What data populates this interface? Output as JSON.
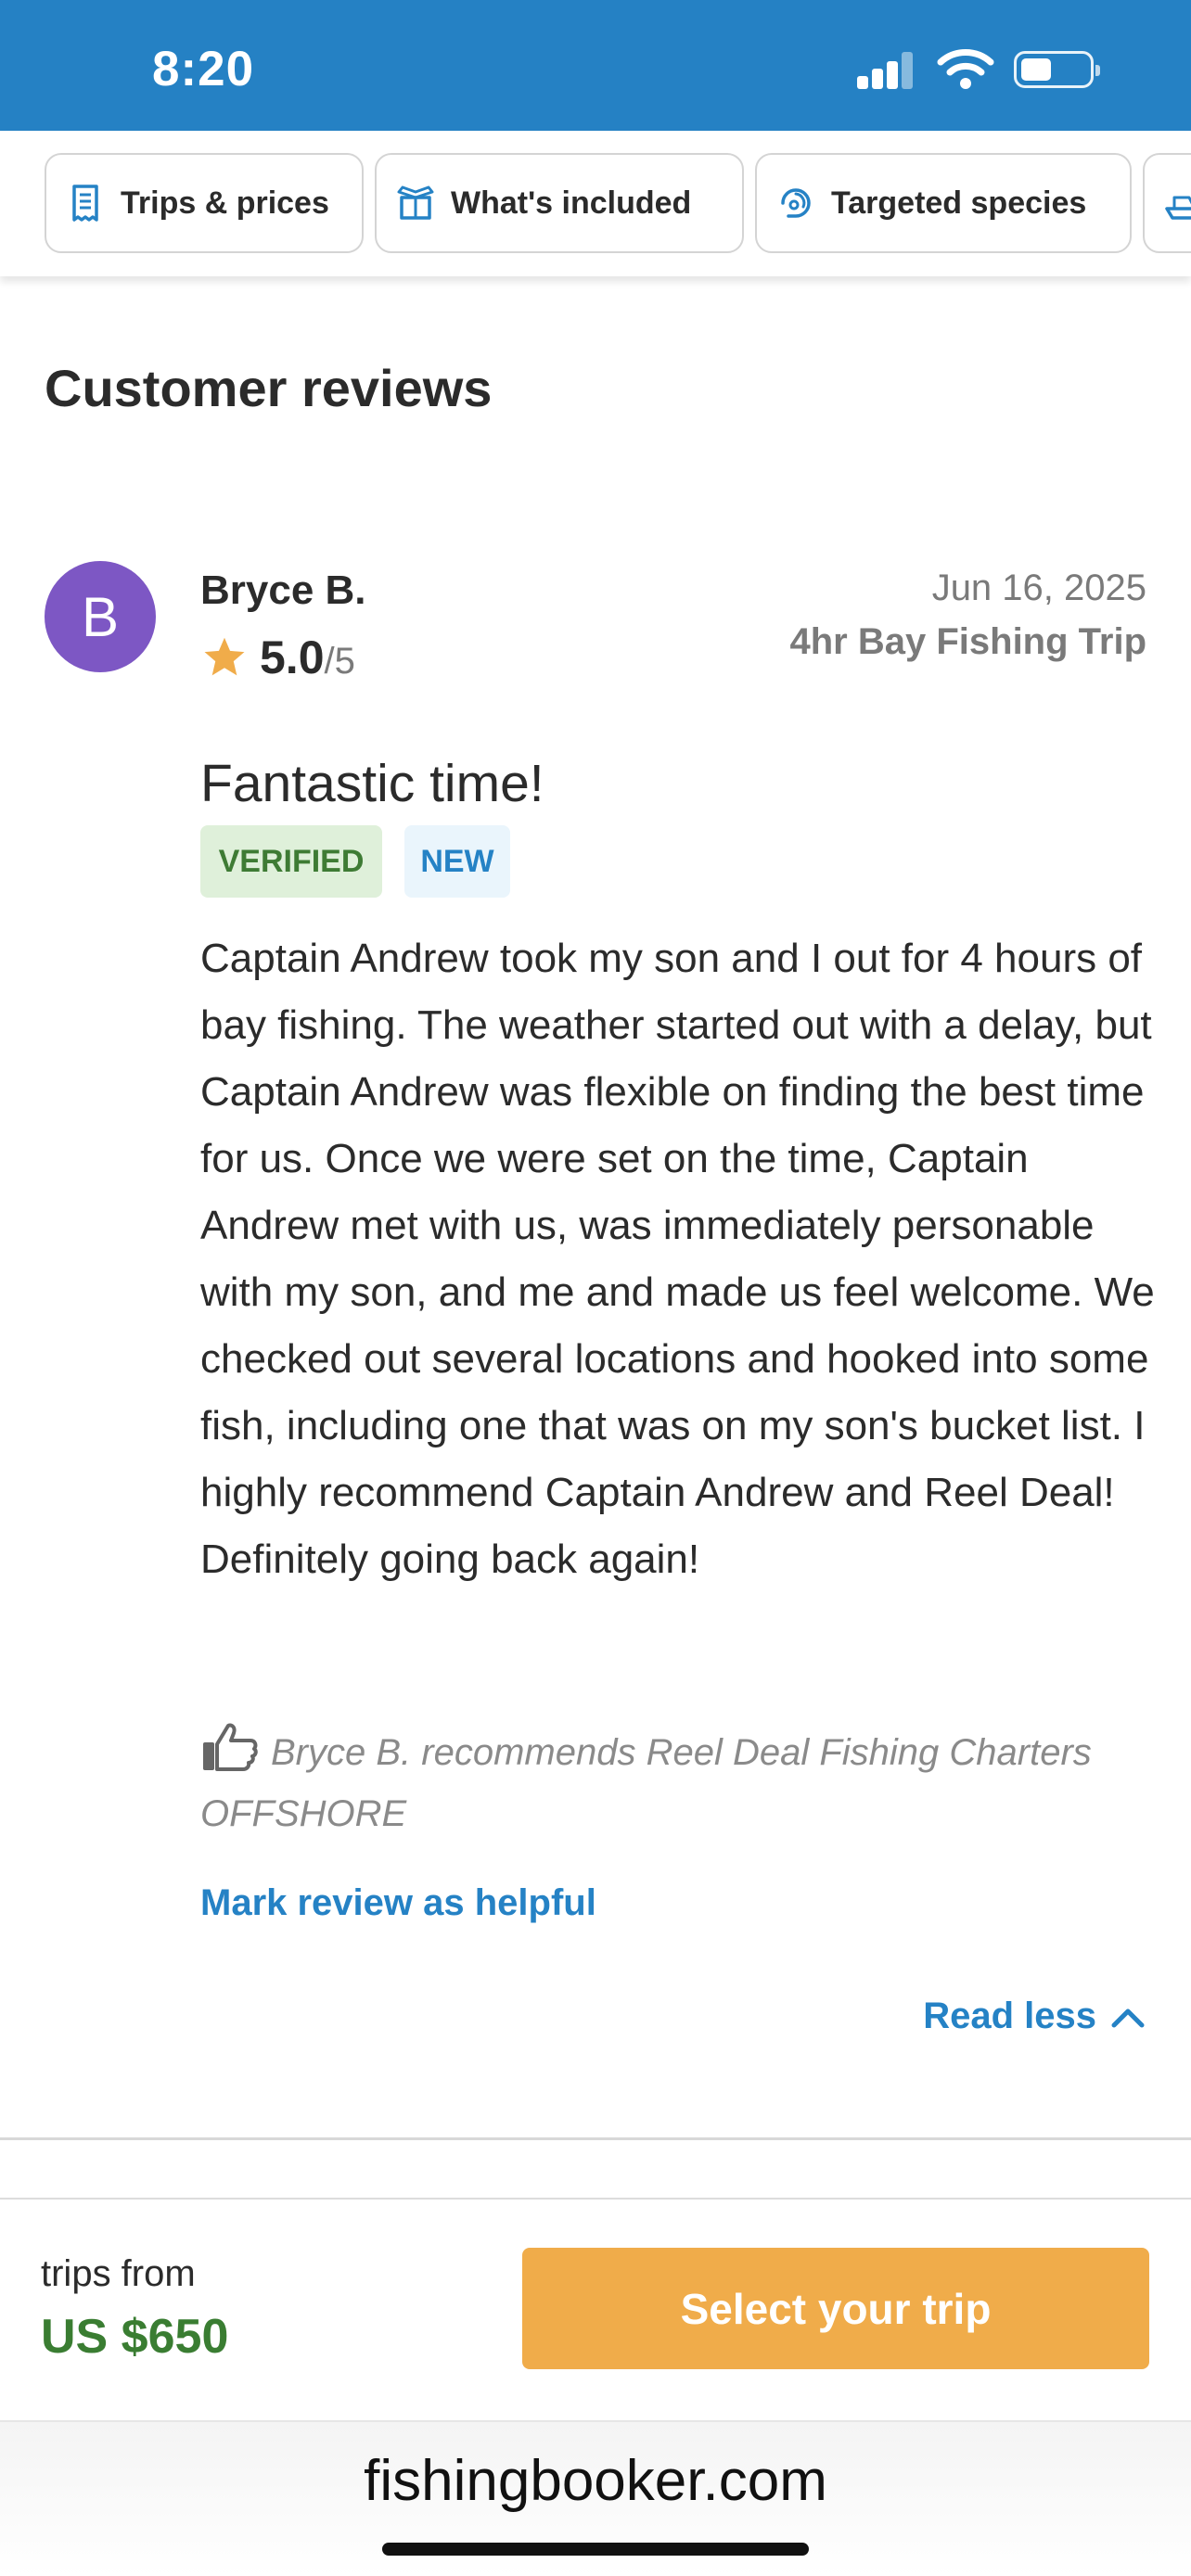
{
  "status_bar": {
    "time": "8:20",
    "icons": [
      "signal-icon",
      "wifi-icon",
      "battery-icon"
    ]
  },
  "tabs": [
    {
      "label": "Trips & prices",
      "icon": "receipt-icon"
    },
    {
      "label": "What's included",
      "icon": "package-icon"
    },
    {
      "label": "Targeted species",
      "icon": "fish-hook-icon"
    },
    {
      "label": "",
      "icon": "boat-icon"
    }
  ],
  "section": {
    "title": "Customer reviews"
  },
  "review": {
    "avatar_initial": "B",
    "avatar_color": "#7d57c4",
    "reviewer": "Bryce B.",
    "rating": "5.0",
    "rating_scale": "/5",
    "date": "Jun 16, 2025",
    "trip": "4hr Bay Fishing Trip",
    "title": "Fantastic time!",
    "badges": {
      "verified": "VERIFIED",
      "new": "NEW"
    },
    "body": "Captain Andrew took my son and I out for 4 hours of bay fishing.  The weather started out with a delay, but Captain Andrew was flexible on finding the best time for us.  Once we were set on the time, Captain Andrew met with us, was immediately personable with my son, and me and made us feel welcome.  We checked out several locations and hooked into some fish, including one that was on my son's bucket list.  I highly recommend Captain Andrew and Reel Deal!  Definitely going back again!",
    "recommendation": "Bryce B. recommends Reel Deal Fishing Charters OFFSHORE",
    "helpful_link": "Mark review as helpful",
    "read_less": "Read less"
  },
  "footer": {
    "trips_from": "trips from",
    "price": "US $650",
    "cta": "Select your trip"
  },
  "browser": {
    "url": "fishingbooker.com"
  },
  "colors": {
    "status_bar": "#2581c4",
    "link": "#2582c5",
    "price": "#3a7d32",
    "cta": "#f0ac4a",
    "star": "#f0ac4a",
    "verified_bg": "#dff0da",
    "new_bg": "#eaf5fc"
  }
}
